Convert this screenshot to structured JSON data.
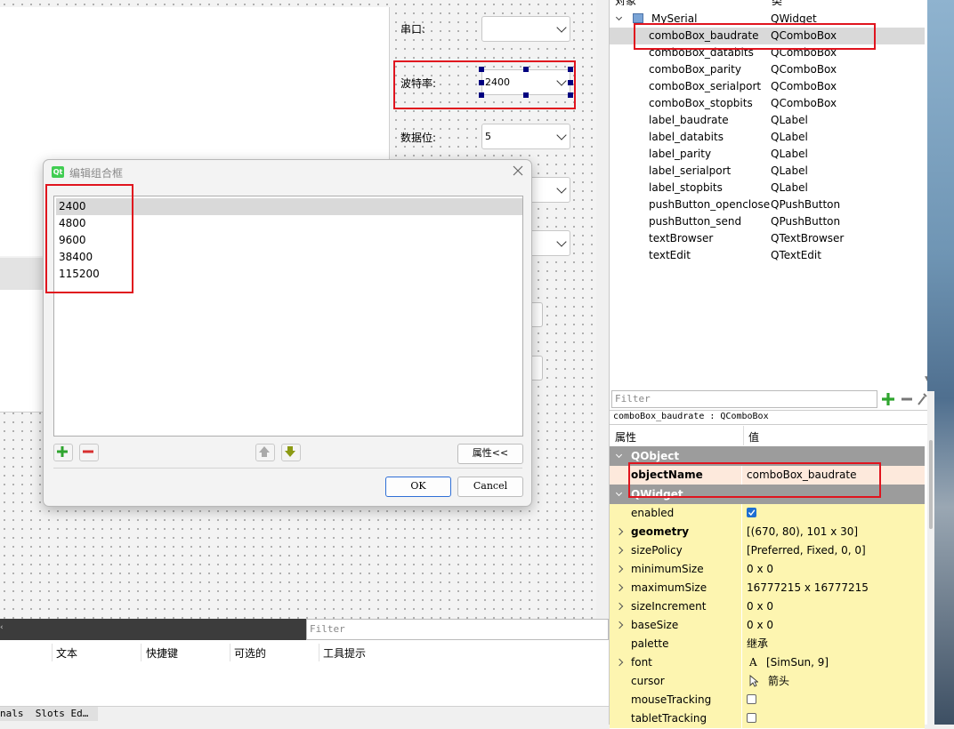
{
  "form": {
    "labels": {
      "serial": "串口:",
      "baud": "波特率:",
      "databits": "数据位:"
    },
    "combo_baud_value": "2400",
    "combo_databits_value": "5"
  },
  "dialog": {
    "title": "编辑组合框",
    "items": [
      "2400",
      "4800",
      "9600",
      "38400",
      "115200"
    ],
    "selected_index": 0,
    "properties_button": "属性<<",
    "ok": "OK",
    "cancel": "Cancel"
  },
  "object_inspector": {
    "col_object": "对象",
    "col_class": "类",
    "root": {
      "name": "MySerial",
      "class": "QWidget"
    },
    "rows": [
      {
        "name": "comboBox_baudrate",
        "class": "QComboBox"
      },
      {
        "name": "comboBox_databits",
        "class": "QComboBox"
      },
      {
        "name": "comboBox_parity",
        "class": "QComboBox"
      },
      {
        "name": "comboBox_serialport",
        "class": "QComboBox"
      },
      {
        "name": "comboBox_stopbits",
        "class": "QComboBox"
      },
      {
        "name": "label_baudrate",
        "class": "QLabel"
      },
      {
        "name": "label_databits",
        "class": "QLabel"
      },
      {
        "name": "label_parity",
        "class": "QLabel"
      },
      {
        "name": "label_serialport",
        "class": "QLabel"
      },
      {
        "name": "label_stopbits",
        "class": "QLabel"
      },
      {
        "name": "pushButton_openclose",
        "class": "QPushButton"
      },
      {
        "name": "pushButton_send",
        "class": "QPushButton"
      },
      {
        "name": "textBrowser",
        "class": "QTextBrowser"
      },
      {
        "name": "textEdit",
        "class": "QTextEdit"
      }
    ]
  },
  "property_editor": {
    "filter_placeholder": "Filter",
    "caption": "comboBox_baudrate : QComboBox",
    "col_property": "属性",
    "col_value": "值",
    "section_qobject": "QObject",
    "section_qwidget": "QWidget",
    "object_name": {
      "key": "objectName",
      "value": "comboBox_baudrate"
    },
    "rows": [
      {
        "key": "enabled",
        "value": "",
        "bold": false,
        "expand": false,
        "type": "check-on"
      },
      {
        "key": "geometry",
        "value": "[(670, 80), 101 x 30]",
        "bold": true,
        "expand": true
      },
      {
        "key": "sizePolicy",
        "value": "[Preferred, Fixed, 0, 0]",
        "bold": false,
        "expand": true
      },
      {
        "key": "minimumSize",
        "value": "0 x 0",
        "bold": false,
        "expand": true
      },
      {
        "key": "maximumSize",
        "value": "16777215 x 16777215",
        "bold": false,
        "expand": true
      },
      {
        "key": "sizeIncrement",
        "value": "0 x 0",
        "bold": false,
        "expand": true
      },
      {
        "key": "baseSize",
        "value": "0 x 0",
        "bold": false,
        "expand": true
      },
      {
        "key": "palette",
        "value": "继承",
        "bold": false,
        "expand": false
      },
      {
        "key": "font",
        "value": "[SimSun, 9]",
        "bold": false,
        "expand": true,
        "type": "font"
      },
      {
        "key": "cursor",
        "value": "箭头",
        "bold": false,
        "expand": false,
        "type": "cursor"
      },
      {
        "key": "mouseTracking",
        "value": "",
        "bold": false,
        "expand": false,
        "type": "check-off"
      },
      {
        "key": "tabletTracking",
        "value": "",
        "bold": false,
        "expand": false,
        "type": "check-off"
      }
    ]
  },
  "action_editor": {
    "filter_placeholder": "Filter",
    "columns": [
      "文本",
      "快捷键",
      "可选的",
      "工具提示"
    ],
    "bottom_tabs": "nals  Slots Ed…"
  },
  "colors": {
    "selection_red": "#e0141e",
    "prop_yellow": "#fdf5b0",
    "prop_header": "#9c9c9c"
  }
}
